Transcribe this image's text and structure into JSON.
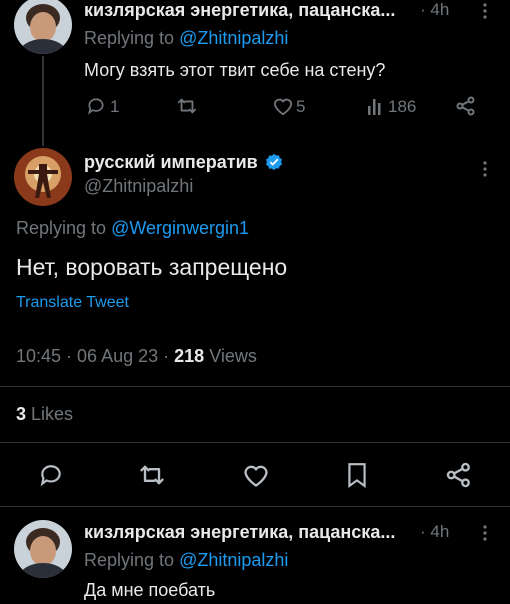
{
  "reply_top": {
    "author": "кизлярская энергетика, пацанска...",
    "time": "4h",
    "replying_prefix": "Replying to ",
    "replying_handle": "@Zhitnipalzhi",
    "text": "Могу взять этот твит себе на стену?",
    "replies": "1",
    "likes": "5",
    "views": "186"
  },
  "main_tweet": {
    "author": "русский императив",
    "handle": "@Zhitnipalzhi",
    "replying_prefix": "Replying to ",
    "replying_handle": "@Werginwergin1",
    "text": "Нет, воровать запрещено",
    "translate": "Translate Tweet",
    "time": "10:45",
    "date": "06 Aug 23",
    "views_count": "218",
    "views_label": "Views",
    "likes_count": "3",
    "likes_label": "Likes"
  },
  "reply_bottom": {
    "author": "кизлярская энергетика, пацанска...",
    "time": "4h",
    "replying_prefix": "Replying to ",
    "replying_handle": "@Zhitnipalzhi",
    "text": "Да мне поебать"
  },
  "colors": {
    "background": "#000000",
    "text": "#e7e9ea",
    "muted": "#71767b",
    "link": "#1d9bf0",
    "verified": "#1d9bf0"
  },
  "icons": [
    "reply-icon",
    "retweet-icon",
    "like-icon",
    "views-icon",
    "share-icon",
    "bookmark-icon",
    "more-icon",
    "verified-badge-icon"
  ]
}
